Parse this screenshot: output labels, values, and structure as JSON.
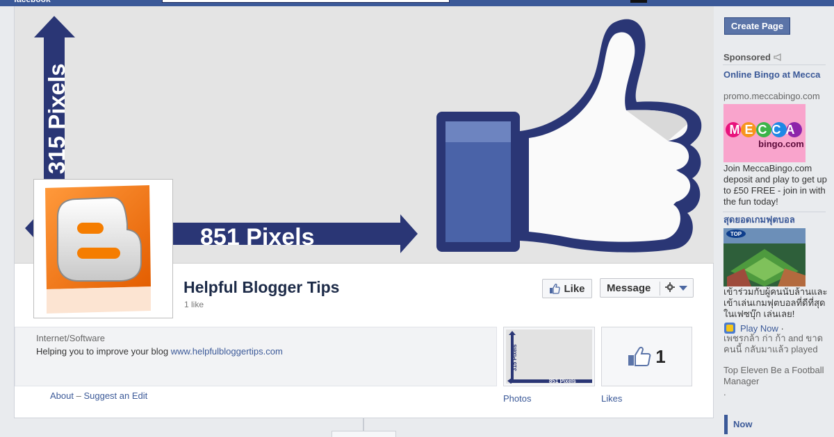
{
  "app": {
    "brand": "facebook"
  },
  "cover": {
    "vertical_label": "315 Pixels",
    "horizontal_label": "851 Pixels"
  },
  "page": {
    "name": "Helpful Blogger Tips",
    "likes_text": "1 like",
    "category": "Internet/Software",
    "description": "Helping you to improve your blog",
    "website": "www.helpfulbloggertips.com",
    "about_link": "About",
    "separator": "–",
    "suggest_link": "Suggest an Edit"
  },
  "actions": {
    "like_label": "Like",
    "message_label": "Message"
  },
  "thumbs": {
    "photos_label": "Photos",
    "likes_label": "Likes",
    "likes_number": "1",
    "photo_vertical": "315 Pixels",
    "photo_horizontal": "851 Pixels"
  },
  "sidebar": {
    "create_page_label": "Create Page",
    "sponsored_label": "Sponsored",
    "ads": [
      {
        "title": "Online Bingo at Mecca",
        "url": "promo.meccabingo.com",
        "image_text_top": "MECCA",
        "image_text_bottom": "bingo.com",
        "text": "Join MeccaBingo.com deposit and play to get up to £50 FREE - join in with the fun today!"
      },
      {
        "title": "สุดยอดเกมฟุตบอล",
        "image_text": "TOP",
        "text": "เข้าร่วมกับผู้คนนับล้านและเข้าเล่นเกมฟุตบอลที่ดีที่สุดในเฟซบุ๊ก เล่นเลย!",
        "play_label": "Play Now",
        "play_suffix": "·",
        "social_text": "เพชรกล้า ก่า ก้า and ขาดคนนี้ กลับมาแล้ว played",
        "game_name": "Top Eleven Be a Football Manager",
        "dot": "."
      }
    ],
    "now_label": "Now"
  },
  "colors": {
    "facebook_blue": "#3b5998",
    "cover_navy": "#2d3a7a",
    "blogger_orange": "#f57d00"
  }
}
